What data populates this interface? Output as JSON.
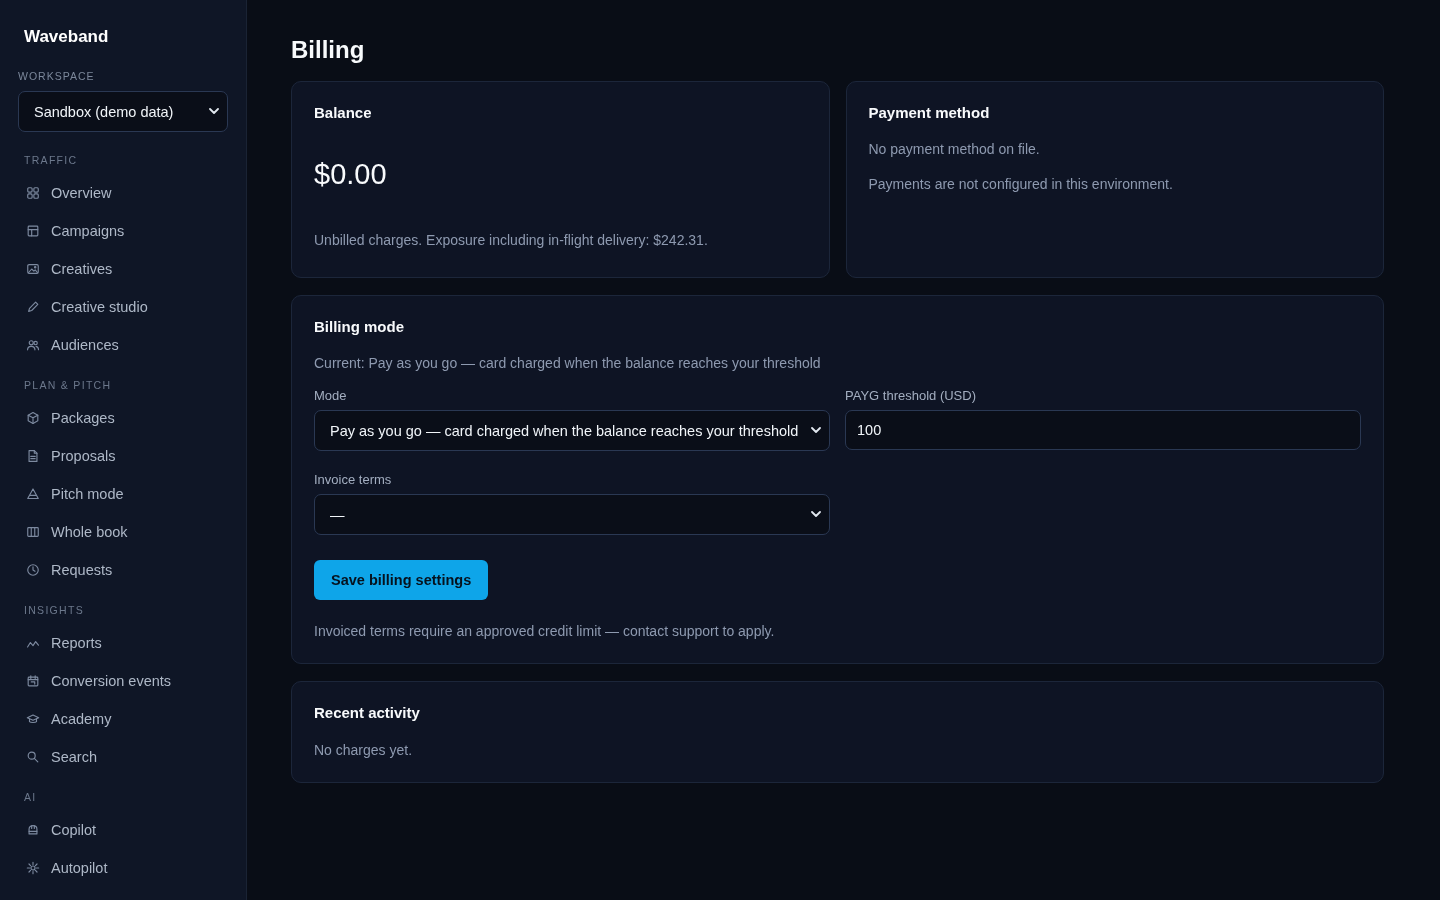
{
  "sidebar": {
    "brand": "Waveband",
    "workspace": {
      "label": "WORKSPACE",
      "value": "Sandbox (demo data)"
    },
    "sections": [
      {
        "title": "TRAFFIC",
        "items": [
          {
            "label": "Overview"
          },
          {
            "label": "Campaigns"
          },
          {
            "label": "Creatives"
          },
          {
            "label": "Creative studio"
          },
          {
            "label": "Audiences"
          }
        ]
      },
      {
        "title": "PLAN & PITCH",
        "items": [
          {
            "label": "Packages"
          },
          {
            "label": "Proposals"
          },
          {
            "label": "Pitch mode"
          },
          {
            "label": "Whole book"
          },
          {
            "label": "Requests"
          }
        ]
      },
      {
        "title": "INSIGHTS",
        "items": [
          {
            "label": "Reports"
          },
          {
            "label": "Conversion events"
          },
          {
            "label": "Academy"
          },
          {
            "label": "Search"
          }
        ]
      },
      {
        "title": "AI",
        "items": [
          {
            "label": "Copilot"
          },
          {
            "label": "Autopilot"
          }
        ]
      }
    ]
  },
  "page": {
    "title": "Billing"
  },
  "balance": {
    "title": "Balance",
    "amount": "$0.00",
    "note": "Unbilled charges. Exposure including in-flight delivery: $242.31."
  },
  "payment_method": {
    "title": "Payment method",
    "lines": [
      "No payment method on file.",
      "Payments are not configured in this environment."
    ]
  },
  "billing_mode": {
    "title": "Billing mode",
    "current": "Current: Pay as you go — card charged when the balance reaches your threshold",
    "fields": [
      {
        "kind": "select",
        "label": "Mode",
        "value": "Pay as you go — card charged when the balance reaches your threshold"
      },
      {
        "kind": "input",
        "label": "PAYG threshold (USD)",
        "value": "100"
      },
      {
        "kind": "select",
        "label": "Invoice terms",
        "value": "—"
      }
    ],
    "save_button": "Save billing settings",
    "note": "Invoiced terms require an approved credit limit — contact support to apply."
  },
  "recent_activity": {
    "title": "Recent activity",
    "empty": "No charges yet."
  }
}
